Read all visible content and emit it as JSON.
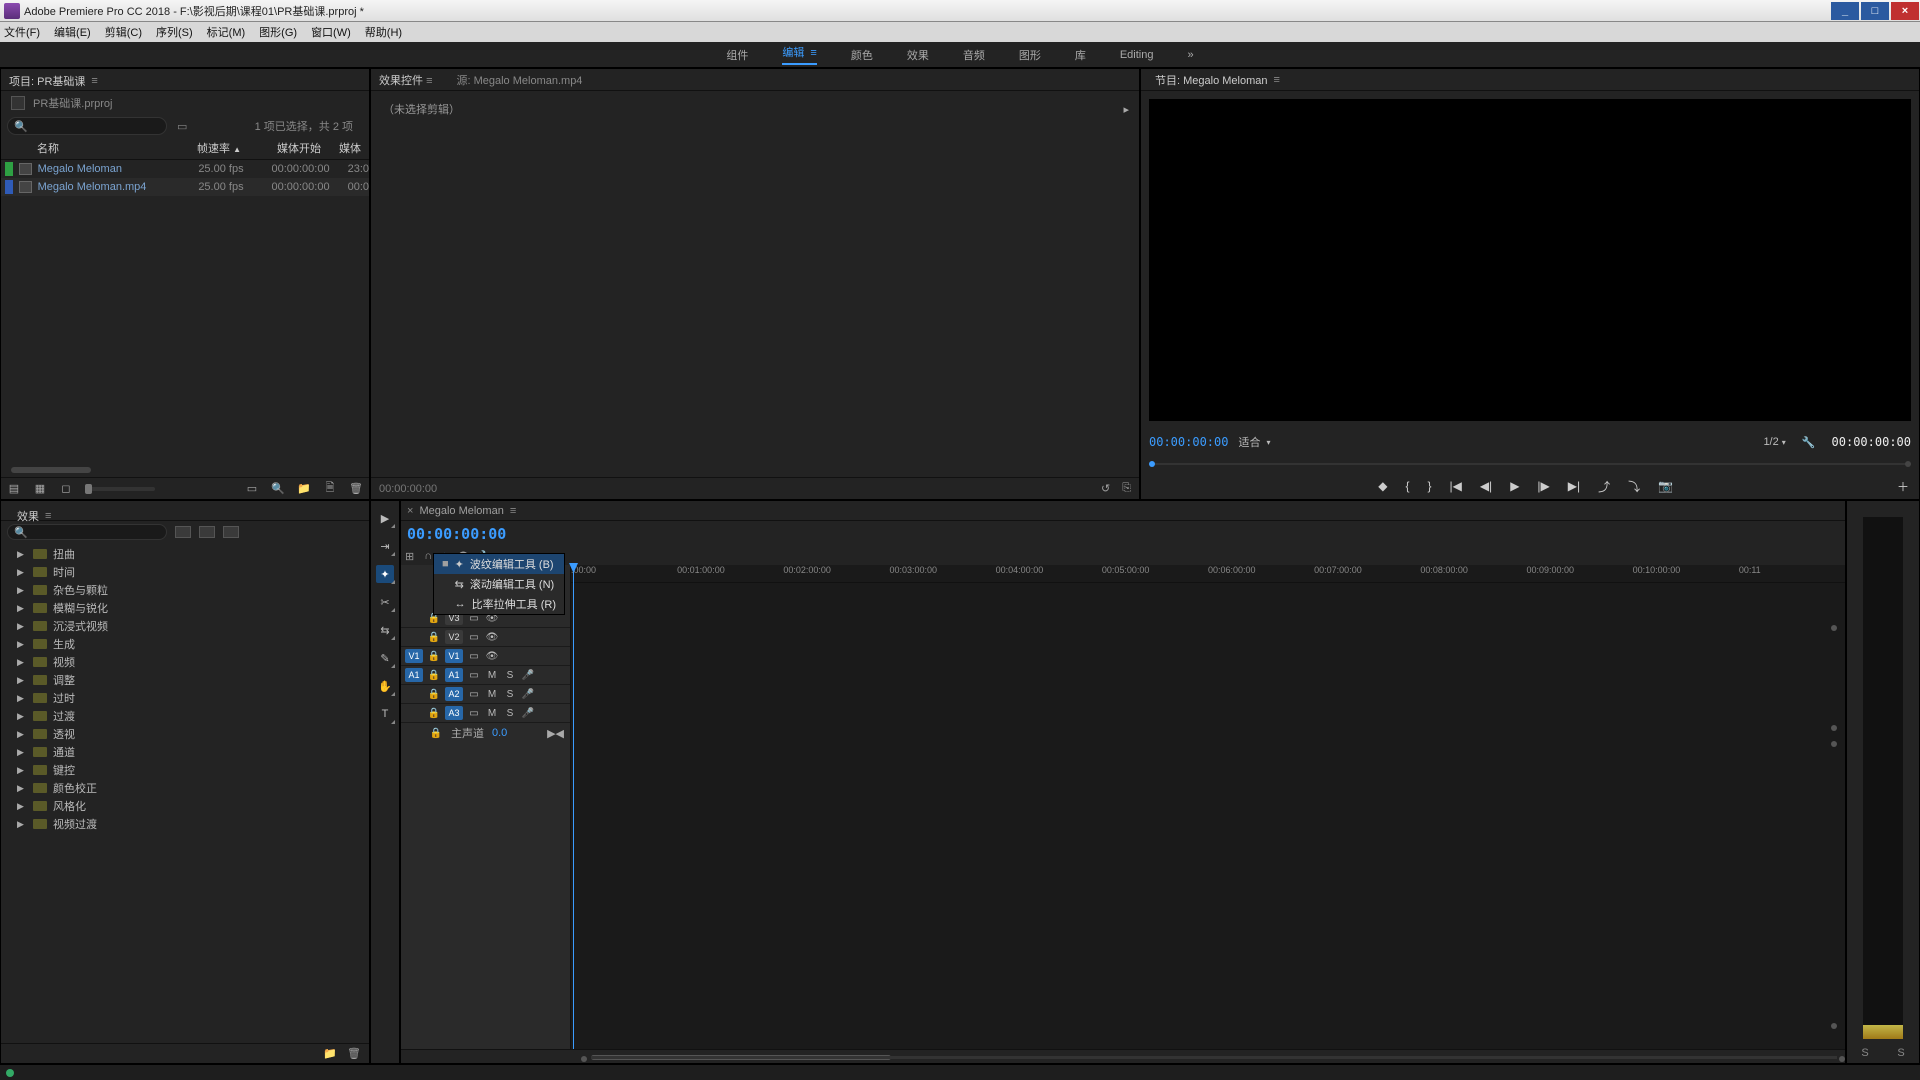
{
  "title": "Adobe Premiere Pro CC 2018 - F:\\影视后期\\课程01\\PR基础课.prproj *",
  "menus": [
    "文件(F)",
    "编辑(E)",
    "剪辑(C)",
    "序列(S)",
    "标记(M)",
    "图形(G)",
    "窗口(W)",
    "帮助(H)"
  ],
  "workspaces": {
    "items": [
      "组件",
      "编辑",
      "颜色",
      "效果",
      "音频",
      "图形",
      "库",
      "Editing"
    ],
    "active": "编辑",
    "more": "»"
  },
  "project": {
    "tab": "项目: PR基础课",
    "file": "PR基础课.prproj",
    "selection_info": "1 项已选择，共 2 项",
    "columns": {
      "name": "名称",
      "fps": "帧速率",
      "start": "媒体开始",
      "end": "媒体"
    },
    "rows": [
      {
        "name": "Megalo Meloman",
        "fps": "25.00 fps",
        "start": "00:00:00:00",
        "end": "23:0"
      },
      {
        "name": "Megalo Meloman.mp4",
        "fps": "25.00 fps",
        "start": "00:00:00:00",
        "end": "00:0"
      }
    ]
  },
  "effect_controls": {
    "tab": "效果控件",
    "source_tab": "源: Megalo Meloman.mp4",
    "empty": "（未选择剪辑）",
    "footer_time": "00:00:00:00"
  },
  "program": {
    "tab": "节目: Megalo Meloman",
    "tc_left": "00:00:00:00",
    "fit": "适合",
    "zoom": "1/2",
    "tc_right": "00:00:00:00"
  },
  "effects_panel": {
    "tab": "效果",
    "items": [
      "扭曲",
      "时间",
      "杂色与颗粒",
      "模糊与锐化",
      "沉浸式视频",
      "生成",
      "视频",
      "调整",
      "过时",
      "过渡",
      "透视",
      "通道",
      "键控",
      "颜色校正",
      "风格化",
      "视频过渡"
    ]
  },
  "timeline": {
    "tab": "Megalo Meloman",
    "tc": "00:00:00:00",
    "ticks": [
      ":00:00",
      "00:01:00:00",
      "00:02:00:00",
      "00:03:00:00",
      "00:04:00:00",
      "00:05:00:00",
      "00:06:00:00",
      "00:07:00:00",
      "00:08:00:00",
      "00:09:00:00",
      "00:10:00:00",
      "00:11"
    ],
    "video_tracks": [
      "V3",
      "V2",
      "V1"
    ],
    "audio_tracks": [
      "A1",
      "A2",
      "A3"
    ],
    "master": "主声道",
    "master_val": "0.0",
    "tool_flyout": [
      {
        "label": "波纹编辑工具 (B)",
        "sel": true
      },
      {
        "label": "滚动编辑工具 (N)",
        "sel": false
      },
      {
        "label": "比率拉伸工具 (R)",
        "sel": false
      }
    ]
  },
  "meter": {
    "l": "S",
    "r": "S"
  }
}
